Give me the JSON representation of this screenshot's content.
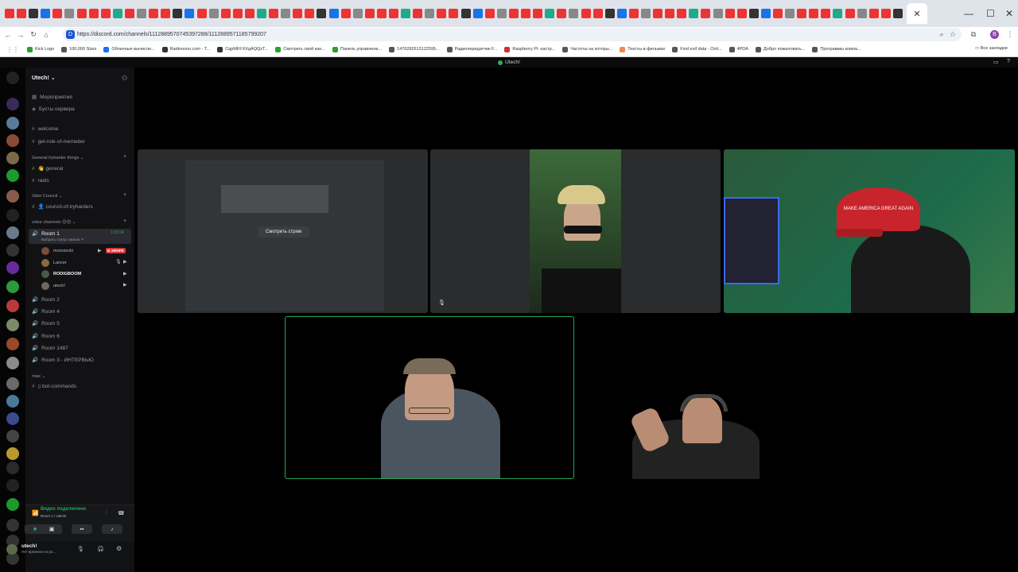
{
  "browser": {
    "url": "https://discord.com/channels/1112889570745397288/1112889571185799207",
    "bookmarks": [
      "Kick Logo",
      "100,000 Stars",
      "Облачные вычисле...",
      "Radiooooo.com - T...",
      "CqpMFFXXgAQQzT...",
      "Смотреть свой кан...",
      "Панель управлени...",
      "1476282613122595...",
      "Радиопередатчик F...",
      "Raspberry Pi: настр...",
      "Частоты на которы...",
      "Тексты в фильмах",
      "Find exif data - Onli...",
      "4PDA",
      "Добро пожаловать...",
      "Программы компа..."
    ],
    "all_bookmarks": "Все закладки",
    "avatar_letter": "B"
  },
  "discord": {
    "window_title": "Utech!",
    "guild_name": "Utech!",
    "top_items": [
      "Мероприятия",
      "Бусты сервера"
    ],
    "text_channels": [
      "welcome",
      "get-role-of-memeber"
    ],
    "categories": {
      "general": "General tryharder things",
      "valor": "Valor Council",
      "voice": "voice channels",
      "misc": "misc"
    },
    "general_channels": [
      "general",
      "raids"
    ],
    "valor_channels": [
      "council-of-tryharders"
    ],
    "active_room": "Room 1",
    "active_room_timer": "1:31:04",
    "active_room_status": "Выбрать статус канала",
    "voice_users": [
      "morozecki",
      "Lancer",
      "RODIGBOOM",
      "utech!"
    ],
    "live_badge": "В ЭФИРЕ",
    "rooms": [
      "Room 2",
      "Room 4",
      "Room 5",
      "Room 6",
      "Room 1487",
      "Room 3 - ИНТЕРВЬЮ"
    ],
    "misc_channels": [
      "bot-commands"
    ],
    "voice_status": "Видео подключено",
    "voice_location": "Room 1 / Utech!",
    "username": "utech!",
    "user_status": "Нет времени на ра...",
    "watch_stream_label": "Смотреть стрим",
    "cap_text": "MAKE AMERICA GREAT AGAIN"
  },
  "colors": {
    "accent_green": "#23a55a",
    "live_red": "#da373c",
    "cap_red": "#c8242b"
  }
}
